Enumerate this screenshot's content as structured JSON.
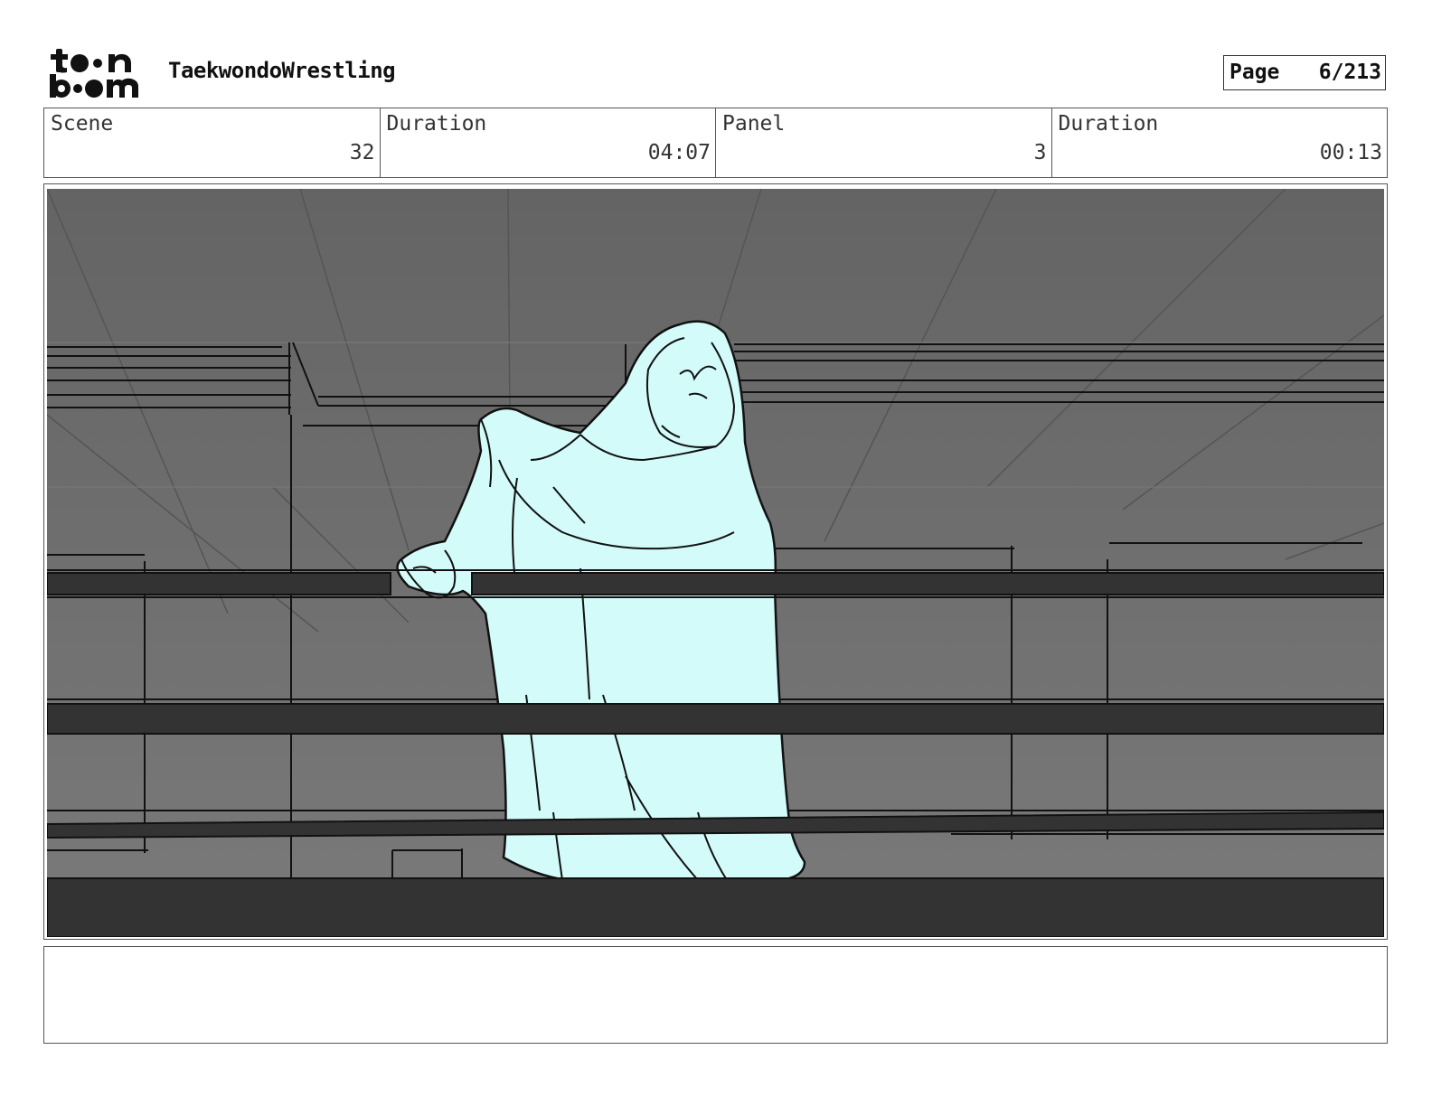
{
  "header": {
    "logo_text": "toon boom",
    "project_title": "TaekwondoWrestling",
    "page_label": "Page",
    "page_value": "6/213"
  },
  "info": {
    "scene_label": "Scene",
    "scene_value": "32",
    "scene_duration_label": "Duration",
    "scene_duration_value": "04:07",
    "panel_label": "Panel",
    "panel_value": "3",
    "panel_duration_label": "Duration",
    "panel_duration_value": "00:13"
  },
  "notes": {
    "text": ""
  },
  "colors": {
    "figure_fill": "#d3fbf9",
    "background_gray": "#6b6b6b",
    "ropes": "#333333"
  }
}
